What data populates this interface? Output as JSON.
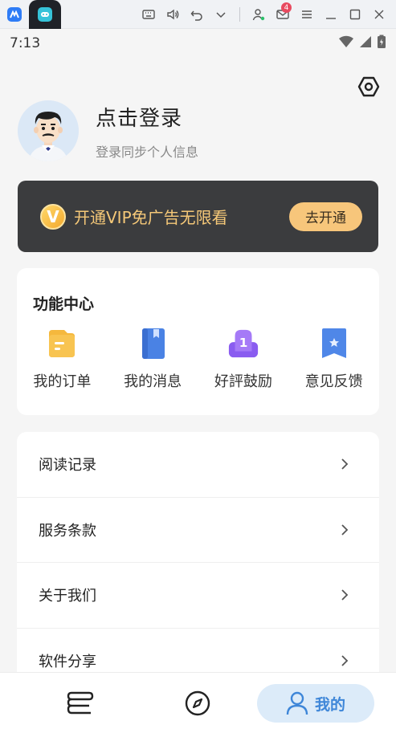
{
  "emulator": {
    "tabs": [
      {
        "icon": "multi-instance-icon",
        "color": "#2e7cf6"
      },
      {
        "icon": "gamepad-app-icon",
        "color": "#36c3d9"
      }
    ],
    "toolbar": {
      "icons": [
        "keyboard-icon",
        "volume-icon",
        "back-icon",
        "chevron-down-icon",
        "account-icon",
        "mail-icon",
        "menu-icon",
        "minimize-icon",
        "maximize-icon",
        "close-icon"
      ],
      "mail_badge": "4"
    }
  },
  "status_bar": {
    "time": "7:13",
    "icons": [
      "wifi-icon",
      "signal-icon",
      "battery-icon"
    ]
  },
  "profile": {
    "login_title": "点击登录",
    "login_subtitle": "登录同步个人信息"
  },
  "vip": {
    "badge_letter": "V",
    "text": "开通VIP免广告无限看",
    "button": "去开通",
    "accent": "#f5c878"
  },
  "function_center": {
    "title": "功能中心",
    "items": [
      {
        "label": "我的订单",
        "icon": "order-icon"
      },
      {
        "label": "我的消息",
        "icon": "message-icon"
      },
      {
        "label": "好評鼓励",
        "icon": "rating-icon",
        "icon_text": "1"
      },
      {
        "label": "意见反馈",
        "icon": "feedback-icon"
      }
    ]
  },
  "menu": {
    "items": [
      {
        "label": "阅读记录"
      },
      {
        "label": "服务条款"
      },
      {
        "label": "关于我们"
      },
      {
        "label": "软件分享"
      }
    ]
  },
  "bottom_nav": {
    "items": [
      {
        "icon": "bookshelf-icon"
      },
      {
        "icon": "compass-icon"
      },
      {
        "icon": "user-icon",
        "label": "我的",
        "active": true
      }
    ],
    "active_color": "#3e86d8"
  }
}
